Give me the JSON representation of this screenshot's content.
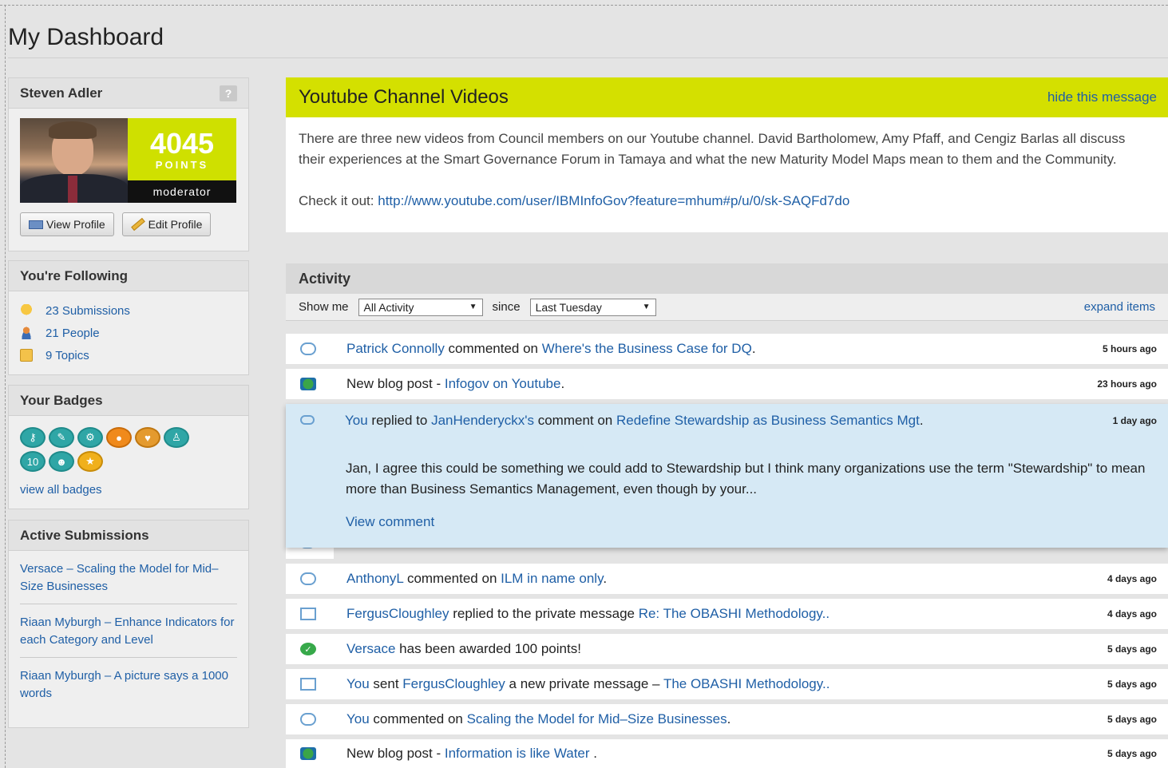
{
  "page": {
    "title": "My Dashboard"
  },
  "profile": {
    "name": "Steven Adler",
    "help": "?",
    "points": "4045",
    "points_label": "POINTS",
    "role": "moderator",
    "view_profile": "View Profile",
    "edit_profile": "Edit Profile"
  },
  "following": {
    "title": "You're Following",
    "items": [
      {
        "label": "23 Submissions",
        "icon": "lightbulb-icon"
      },
      {
        "label": "21 People",
        "icon": "person-icon"
      },
      {
        "label": "9 Topics",
        "icon": "topic-icon"
      }
    ]
  },
  "badges": {
    "title": "Your Badges",
    "items": [
      "key-badge",
      "wrench-badge",
      "gear-badge",
      "speech-badge",
      "heart-badge",
      "person-badge",
      "ten-badge",
      "group-badge",
      "star-badge"
    ],
    "view_all": "view all badges"
  },
  "submissions": {
    "title": "Active Submissions",
    "items": [
      "Versace – Scaling the Model for Mid–Size Businesses",
      "Riaan Myburgh – Enhance Indicators for each Category and Level",
      "Riaan Myburgh – A picture says a 1000 words"
    ]
  },
  "promo": {
    "title": "Youtube Channel Videos",
    "hide": "hide this message",
    "body": "There are three new videos from Council members on our Youtube channel. David Bartholomew, Amy Pfaff, and Cengiz Barlas all discuss their experiences at the Smart Governance Forum in Tamaya and what the new Maturity Model Maps mean to them and the Community.",
    "check_label": "Check it out:",
    "check_link": "http://www.youtube.com/user/IBMInfoGov?feature=mhum#p/u/0/sk-SAQFd7do"
  },
  "activity": {
    "title": "Activity",
    "show_me": "Show me",
    "filter": "All Activity",
    "since": "since",
    "since_value": "Last Tuesday",
    "expand": "expand items",
    "rows": [
      {
        "icon": "comment-icon",
        "a": "Patrick Connolly",
        "t1": " commented on ",
        "b": "Where's the Business Case for DQ",
        "t2": ".",
        "time": "5 hours ago"
      },
      {
        "icon": "blog-icon",
        "a": "",
        "t1": "New blog post - ",
        "b": "Infogov on Youtube",
        "t2": ".",
        "time": "23 hours ago"
      },
      {
        "icon": "comment-icon",
        "a": "AnthonyL",
        "t1": " commented on ",
        "b": "ILM in name only",
        "t2": ".",
        "time": "4 days ago"
      },
      {
        "icon": "mail-icon",
        "a": "FergusCloughley",
        "t1": " replied to the private message ",
        "b": "Re: The OBASHI Methodology..",
        "t2": "",
        "time": "4 days ago"
      },
      {
        "icon": "check-icon",
        "a": "Versace",
        "t1": " has been awarded 100 points!",
        "b": "",
        "t2": "",
        "time": "5 days ago"
      },
      {
        "icon": "mail-icon",
        "a": "You",
        "t1": " sent ",
        "b": "FergusCloughley",
        "t2": " a new private message – ",
        "c": "The OBASHI Methodology..",
        "time": "5 days ago"
      },
      {
        "icon": "comment-icon",
        "a": "You",
        "t1": " commented on ",
        "b": "Scaling the Model for Mid–Size Businesses",
        "t2": ".",
        "time": "5 days ago"
      },
      {
        "icon": "blog-icon",
        "a": "",
        "t1": "New blog post - ",
        "b": "Information is like Water ",
        "t2": ".",
        "time": "5 days ago"
      }
    ],
    "popup": {
      "a": "You",
      "t1": " replied to ",
      "b": "JanHenderyckx's",
      "t2": " comment on ",
      "c": "Redefine Stewardship as Business Semantics Mgt",
      "t3": ".",
      "time": "1 day ago",
      "body": "Jan, I agree this could be something we could add to Stewardship but I think many organizations use the term \"Stewardship\" to mean more than Business Semantics Management, even though by your...",
      "view": "View comment"
    }
  }
}
